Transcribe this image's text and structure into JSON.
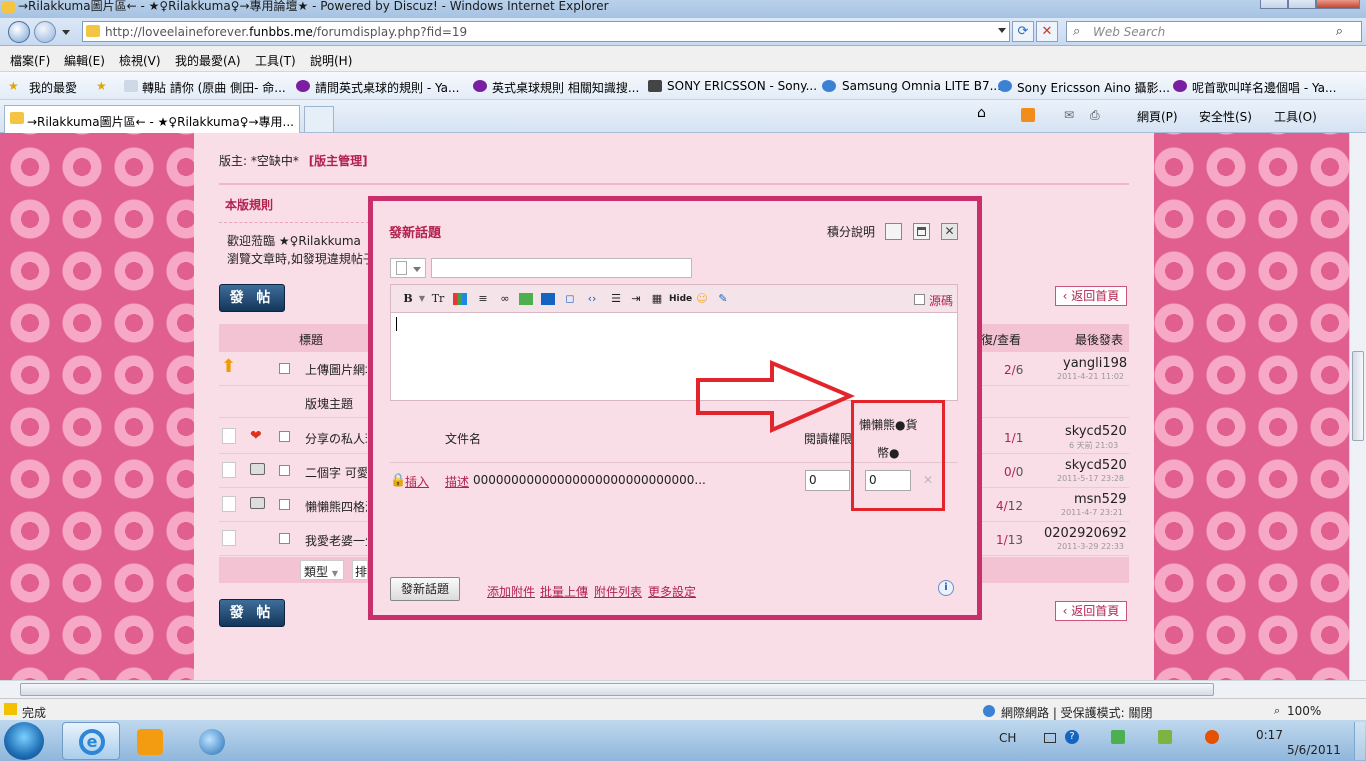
{
  "window": {
    "title": "→Rilakkuma圖片區← - ★♀Rilakkuma♀→專用論壇★ - Powered by Discuz! - Windows Internet Explorer"
  },
  "address": {
    "url_prefix": "http://loveelaineforever.",
    "url_domain": "funbbs.me",
    "url_path": "/forumdisplay.php?fid=19",
    "search_placeholder": "Web Search"
  },
  "menu": [
    "檔案(F)",
    "編輯(E)",
    "檢視(V)",
    "我的最愛(A)",
    "工具(T)",
    "說明(H)"
  ],
  "favorites": {
    "label": "我的最愛",
    "items": [
      "轉貼 請你 (原曲 側田- 命...",
      "請問英式桌球的規則 - Ya...",
      "英式桌球規則 相關知識搜...",
      "SONY ERICSSON - Sony...",
      "Samsung Omnia LITE B7...",
      "Sony Ericsson Aino 攝影...",
      "呢首歌叫咩名邊個唱 - Ya..."
    ]
  },
  "tab": {
    "title": "→Rilakkuma圖片區← - ★♀Rilakkuma♀→專用..."
  },
  "commandbar": {
    "page": "網頁(P)",
    "safety": "安全性(S)",
    "tools": "工具(O)"
  },
  "forum": {
    "moderator_label": "版主: *空缺中*",
    "moderator_manage": "[版主管理]",
    "rules_title": "本版規則",
    "rules_line1": "歡迎蒞臨  ★♀Rilakkuma",
    "rules_line2": "瀏覽文章時,如發現違規帖子",
    "post_button": "發 帖",
    "return_home": "返回首頁",
    "col_title": "標題",
    "col_replies": "回復/查看",
    "col_last": "最後發表",
    "section_label": "版塊主題",
    "threads": [
      {
        "title": "上傳圖片網址",
        "replies": "2",
        "views": "6",
        "last_user": "yangli198",
        "last_time": "2011-4-21 11:02"
      },
      {
        "title": "分享の私人珍",
        "replies": "1",
        "views": "1",
        "last_user": "skycd520",
        "last_time": "6 天前 21:03"
      },
      {
        "title": "二個字 可愛",
        "replies": "0",
        "views": "0",
        "last_user": "skycd520",
        "last_time": "2011-5-17 23:28"
      },
      {
        "title": "懶懶熊四格漫",
        "replies": "4",
        "views": "12",
        "last_user": "msn529",
        "last_time": "2011-4-7 23:21"
      },
      {
        "title": "我愛老婆一生",
        "replies": "1",
        "views": "13",
        "last_user": "0202920692",
        "last_time": "2011-3-29 22:33"
      }
    ],
    "filter_type": "類型",
    "filter_sort": "排"
  },
  "dialog": {
    "title": "發新話題",
    "points_help": "積分說明",
    "source_label": "源碼",
    "hide_label": "Hide",
    "col_filename": "文件名",
    "col_read_perm": "閱讀權限",
    "col_price_line1": "懶懶熊●貨",
    "col_price_line2": "幣●",
    "insert_link": "插入",
    "desc_link": "描述",
    "file_name": "00000000000000000000000000000...",
    "read_perm_value": "0",
    "price_value": "0",
    "submit_button": "發新話題",
    "add_attachment": "添加附件",
    "batch_upload": "批量上傳",
    "attach_list": "附件列表",
    "more_settings": "更多設定",
    "colors": {
      "border": "#c9306b",
      "highlight": "#e3252b"
    }
  },
  "status": {
    "done": "完成",
    "zone": "網際網路 | 受保護模式: 關閉",
    "zoom": "100%"
  },
  "taskbar": {
    "lang": "CH",
    "time": "0:17",
    "date": "5/6/2011"
  }
}
